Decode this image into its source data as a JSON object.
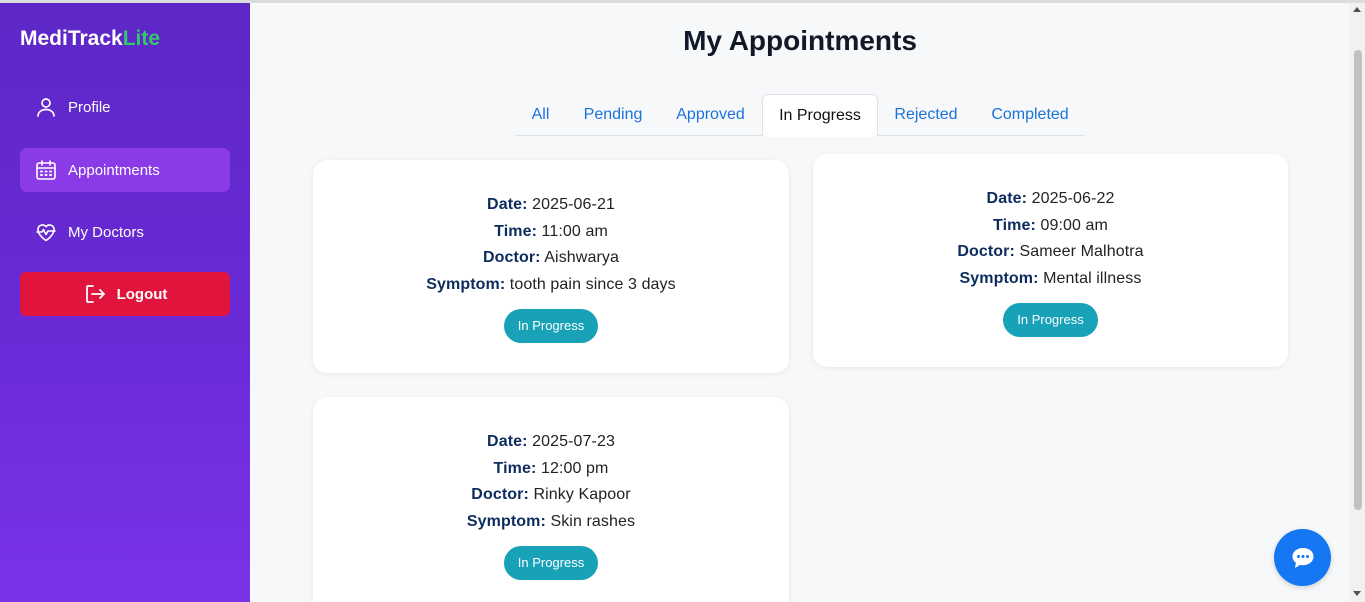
{
  "brand": {
    "name": "MediTrack",
    "suffix": "Lite"
  },
  "sidebar": {
    "items": [
      {
        "label": "Profile",
        "icon": "user-icon"
      },
      {
        "label": "Appointments",
        "icon": "calendar-icon",
        "active": true
      },
      {
        "label": "My Doctors",
        "icon": "heart-pulse-icon"
      }
    ],
    "logout_label": "Logout"
  },
  "page_title": "My Appointments",
  "tabs": [
    {
      "label": "All"
    },
    {
      "label": "Pending"
    },
    {
      "label": "Approved"
    },
    {
      "label": "In Progress",
      "active": true
    },
    {
      "label": "Rejected"
    },
    {
      "label": "Completed"
    }
  ],
  "labels": {
    "date": "Date:",
    "time": "Time:",
    "doctor": "Doctor:",
    "symptom": "Symptom:"
  },
  "appointments": [
    {
      "date": "2025-06-21",
      "time": "11:00 am",
      "doctor": "Aishwarya",
      "symptom": "tooth pain since 3 days",
      "status": "In Progress"
    },
    {
      "date": "2025-06-22",
      "time": "09:00 am",
      "doctor": "Sameer Malhotra",
      "symptom": "Mental illness",
      "status": "In Progress"
    },
    {
      "date": "2025-07-23",
      "time": "12:00 pm",
      "doctor": "Rinky Kapoor",
      "symptom": "Skin rashes",
      "status": "In Progress"
    }
  ],
  "colors": {
    "sidebar_gradient_start": "#5d27c7",
    "sidebar_gradient_end": "#7b33e8",
    "brand_accent": "#34c76c",
    "active_nav": "#8a3ae6",
    "logout": "#e0143c",
    "tab_link": "#1a73d9",
    "status_badge": "#17a2b8",
    "label_text": "#0d2c5e",
    "chat_button": "#1677f2"
  },
  "chat": {
    "icon": "chat-bubble-icon"
  }
}
